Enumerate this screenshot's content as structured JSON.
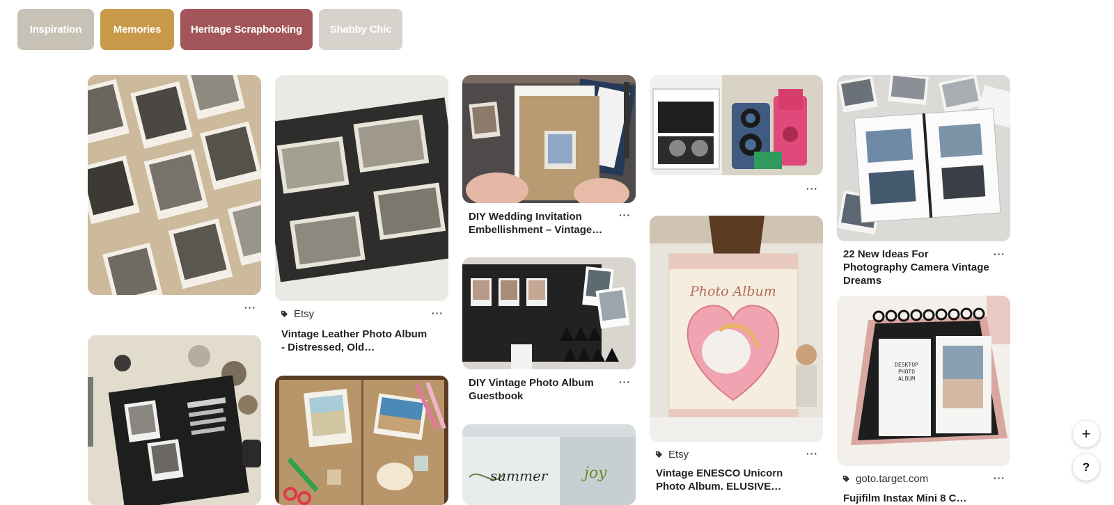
{
  "chips": [
    {
      "label": "Inspiration",
      "color": "#c8c1b5"
    },
    {
      "label": "Memories",
      "color": "#c9994a"
    },
    {
      "label": "Heritage Scrapbooking",
      "color": "#a25659"
    },
    {
      "label": "Shabby Chic",
      "color": "#d6d2cc"
    }
  ],
  "pins": {
    "p1": {
      "title": "",
      "source": ""
    },
    "p2": {
      "title": "Vintage Leather Photo Album - Distressed, Old…",
      "source": "Etsy"
    },
    "p3": {
      "title": "DIY Wedding Invitation Embellishment – Vintage…",
      "source": ""
    },
    "p4": {
      "title": "",
      "source": ""
    },
    "p5": {
      "title": "22 New Ideas For Photography Camera Vintage Dreams",
      "source": ""
    },
    "p6": {
      "title": "DIY Vintage Photo Album Guestbook",
      "source": ""
    },
    "p7": {
      "title": "Vintage ENESCO Unicorn Photo Album. ELUSIVE…",
      "source": "Etsy"
    },
    "p8": {
      "title": "",
      "source": "goto.target.com"
    },
    "p9": {
      "title": "Fujifilm Instax Mini 8 C…",
      "source": ""
    }
  },
  "image_text": {
    "unicorn_album": "Photo Album",
    "desktop_album": "DESKTOP PHOTO ALBUM",
    "summer": "summer",
    "joy": "joy"
  },
  "more_label": "···",
  "fab": {
    "add": "+",
    "help": "?"
  },
  "accent_color": "#e60023"
}
